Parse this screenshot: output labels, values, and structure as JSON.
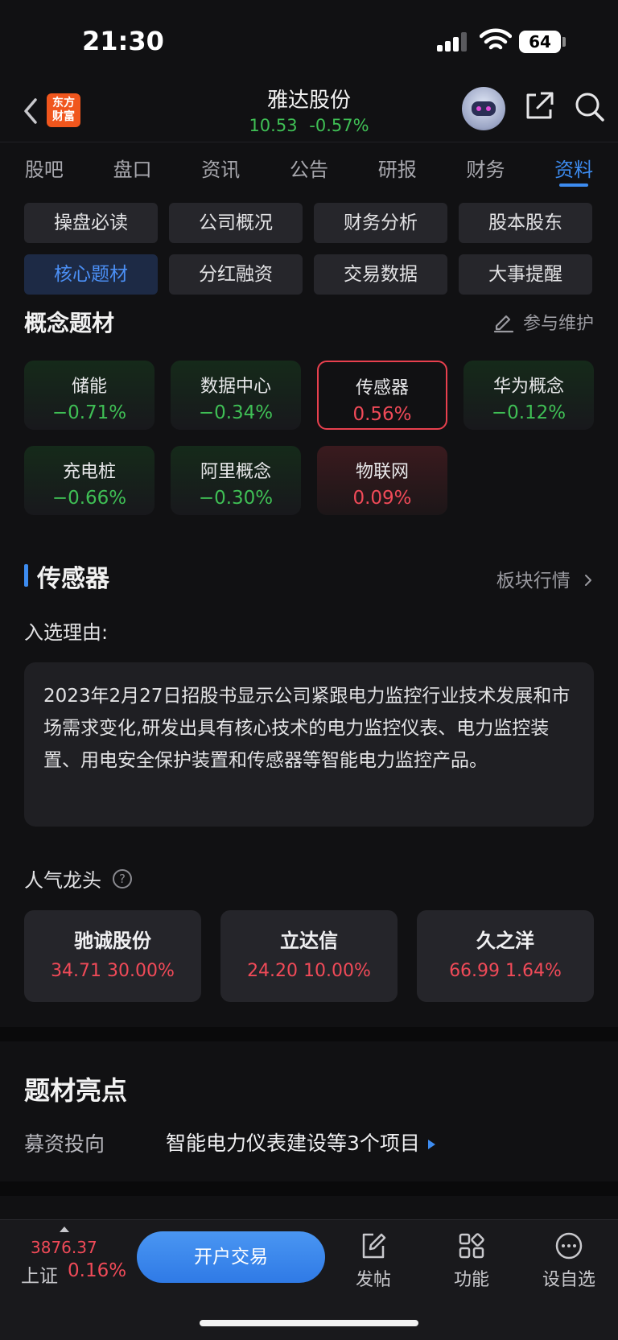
{
  "status_bar": {
    "time": "21:30",
    "battery": "64"
  },
  "header": {
    "brand_line1": "东方",
    "brand_line2": "财富",
    "stock_name": "雅达股份",
    "price": "10.53",
    "change_pct": "-0.57%"
  },
  "tabs": [
    "股吧",
    "盘口",
    "资讯",
    "公告",
    "研报",
    "财务",
    "资料"
  ],
  "active_tab": "资料",
  "subnav": [
    "操盘必读",
    "公司概况",
    "财务分析",
    "股本股东",
    "核心题材",
    "分红融资",
    "交易数据",
    "大事提醒"
  ],
  "active_subnav": "核心题材",
  "concepts": {
    "title": "概念题材",
    "maintain_label": "参与维护",
    "items": [
      {
        "name": "储能",
        "pct": "−0.71%",
        "trend": "down"
      },
      {
        "name": "数据中心",
        "pct": "−0.34%",
        "trend": "down"
      },
      {
        "name": "传感器",
        "pct": "0.56%",
        "trend": "selected"
      },
      {
        "name": "华为概念",
        "pct": "−0.12%",
        "trend": "down"
      },
      {
        "name": "充电桩",
        "pct": "−0.66%",
        "trend": "down"
      },
      {
        "name": "阿里概念",
        "pct": "−0.30%",
        "trend": "down"
      },
      {
        "name": "物联网",
        "pct": "0.09%",
        "trend": "up"
      }
    ]
  },
  "detail": {
    "title": "传感器",
    "sector_link": "板块行情",
    "reason_label": "入选理由:",
    "reason_text": "2023年2月27日招股书显示公司紧跟电力监控行业技术发展和市场需求变化,研发出具有核心技术的电力监控仪表、电力监控装置、用电安全保护装置和传感器等智能电力监控产品。",
    "popular_label": "人气龙头",
    "leaders": [
      {
        "name": "驰诚股份",
        "price": "34.71",
        "pct": "30.00%"
      },
      {
        "name": "立达信",
        "price": "24.20",
        "pct": "10.00%"
      },
      {
        "name": "久之洋",
        "price": "66.99",
        "pct": "1.64%"
      }
    ]
  },
  "highlights": {
    "title": "题材亮点",
    "fund_label": "募资投向",
    "fund_value": "智能电力仪表建设等3个项目"
  },
  "bottom_bar": {
    "index_value": "3876.37",
    "index_name": "上证",
    "index_pct": "0.16%",
    "open_account": "开户交易",
    "post": "发帖",
    "functions": "功能",
    "watchlist": "设自选"
  },
  "colors": {
    "up": "#f04a58",
    "down": "#3fbf55",
    "accent": "#3d8cf0",
    "brand": "#f0561d"
  }
}
